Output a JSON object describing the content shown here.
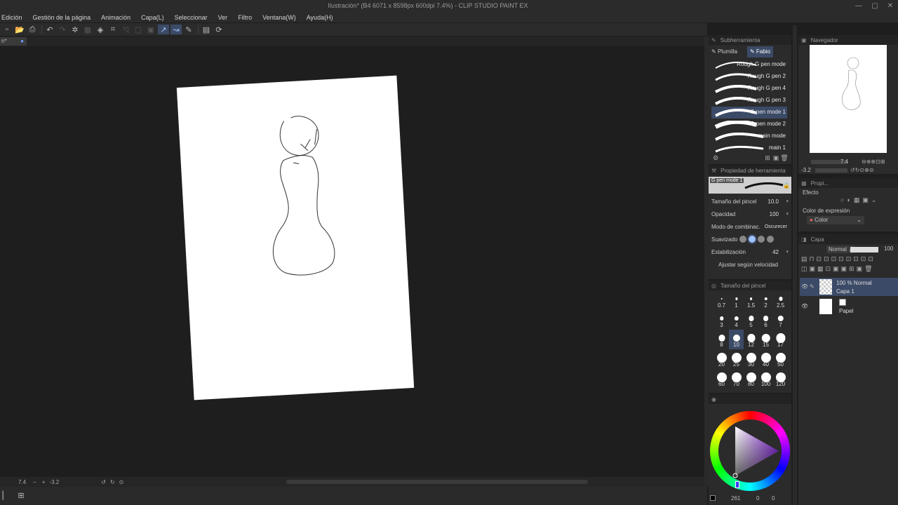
{
  "window": {
    "title": "Ilustración* (B4 6071 x 8598px 600dpi 7.4%) - CLIP STUDIO PAINT EX"
  },
  "menu": [
    "Edición",
    "Gestión de la página",
    "Animación",
    "Capa(L)",
    "Seleccionar",
    "Ver",
    "Filtro",
    "Ventana(W)",
    "Ayuda(H)"
  ],
  "doc_tab": {
    "label": "n*"
  },
  "status": {
    "zoom": "7.4",
    "angle": "-3.2"
  },
  "subtool": {
    "header": "Subherramienta",
    "tabs": [
      "Plumilla",
      "Fabio"
    ],
    "active_tab": 1,
    "brushes": [
      {
        "name": "Rough G pen mode"
      },
      {
        "name": "Rough G pen 2"
      },
      {
        "name": "Rough G pen 4"
      },
      {
        "name": "Rough G pen 3"
      },
      {
        "name": "G pen mode 1",
        "selected": true
      },
      {
        "name": "G pen mode 2"
      },
      {
        "name": "main mode"
      },
      {
        "name": "main 1"
      }
    ]
  },
  "tool_property": {
    "header": "Propiedad de herramienta",
    "preset": "G pen mode 1",
    "rows": [
      {
        "label": "Tamaño del pincel",
        "value": "10.0"
      },
      {
        "label": "Opacidad",
        "value": "100"
      },
      {
        "label": "Modo de combinac.",
        "value": "Oscurecer"
      },
      {
        "label": "Suavizado",
        "value": ""
      },
      {
        "label": "Estabilización",
        "value": "42"
      },
      {
        "label": "Ajustar según velocidad",
        "value": ""
      }
    ]
  },
  "brush_size": {
    "header": "Tamaño del pincel",
    "sizes": [
      "0.7",
      "1",
      "1.5",
      "2",
      "2.5",
      "3",
      "4",
      "5",
      "6",
      "7",
      "8",
      "10",
      "12",
      "15",
      "17",
      "20",
      "25",
      "30",
      "40",
      "50",
      "60",
      "70",
      "80",
      "100",
      "120"
    ],
    "selected": "10"
  },
  "color_wheel": {
    "hue_color": "#8a2be2",
    "values": [
      "261",
      "0",
      "0"
    ]
  },
  "navigator": {
    "header": "Navegador",
    "zoom": "7.4",
    "angle": "-3.2"
  },
  "layer_property": {
    "header": "Propi...",
    "effect_label": "Efecto",
    "expression_label": "Color de expresión",
    "expression_value": "Color"
  },
  "layer_panel": {
    "header": "Capa",
    "blend": "Normal",
    "opacity": "100",
    "layers": [
      {
        "mode": "100 % Normal",
        "name": "Capa 1",
        "selected": true
      },
      {
        "mode": "",
        "name": "Papel",
        "selected": false
      }
    ]
  }
}
